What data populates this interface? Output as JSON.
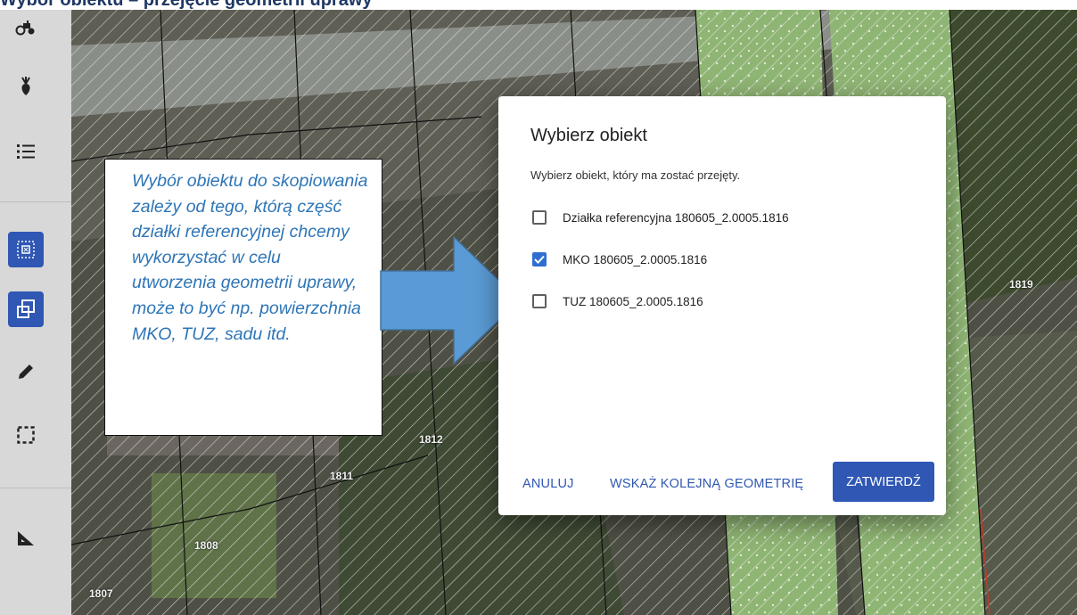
{
  "caption_cropped": "Wybór obiektu – przejęcie geometrii uprawy",
  "toolbar": {
    "items": [
      {
        "icon": "tractor-icon"
      },
      {
        "icon": "beet-icon"
      },
      {
        "icon": "list-icon"
      },
      {
        "icon": "select-area-icon",
        "active": true
      },
      {
        "icon": "copy-geometry-icon",
        "active": true
      },
      {
        "icon": "pencil-icon"
      },
      {
        "icon": "dashed-rectangle-icon"
      },
      {
        "icon": "measure-icon"
      }
    ],
    "active_color": "#2f57b3"
  },
  "map": {
    "parcel_labels": [
      "1819",
      "1812",
      "1811",
      "1808",
      "1807"
    ]
  },
  "callout": {
    "text": "Wybór obiektu do skopiowania zależy od tego, którą część działki referencyjnej chcemy wykorzystać w celu utworzenia geometrii uprawy, może to być np. powierzchnia MKO, TUZ, sadu itd."
  },
  "dialog": {
    "title": "Wybierz obiekt",
    "subtitle": "Wybierz obiekt, który ma zostać przejęty.",
    "options": [
      {
        "label": "Działka referencyjna 180605_2.0005.1816",
        "checked": false
      },
      {
        "label": "MKO 180605_2.0005.1816",
        "checked": true
      },
      {
        "label": "TUZ 180605_2.0005.1816",
        "checked": false
      }
    ],
    "buttons": {
      "cancel": "ANULUJ",
      "next_geometry": "WSKAŻ KOLEJNĄ GEOMETRIĘ",
      "confirm": "ZATWIERDŹ"
    }
  },
  "colors": {
    "accent": "#2f57b3",
    "callout_text": "#2e75b6",
    "arrow_fill": "#5b9bd5",
    "checkbox_checked": "#2f6fd0"
  }
}
